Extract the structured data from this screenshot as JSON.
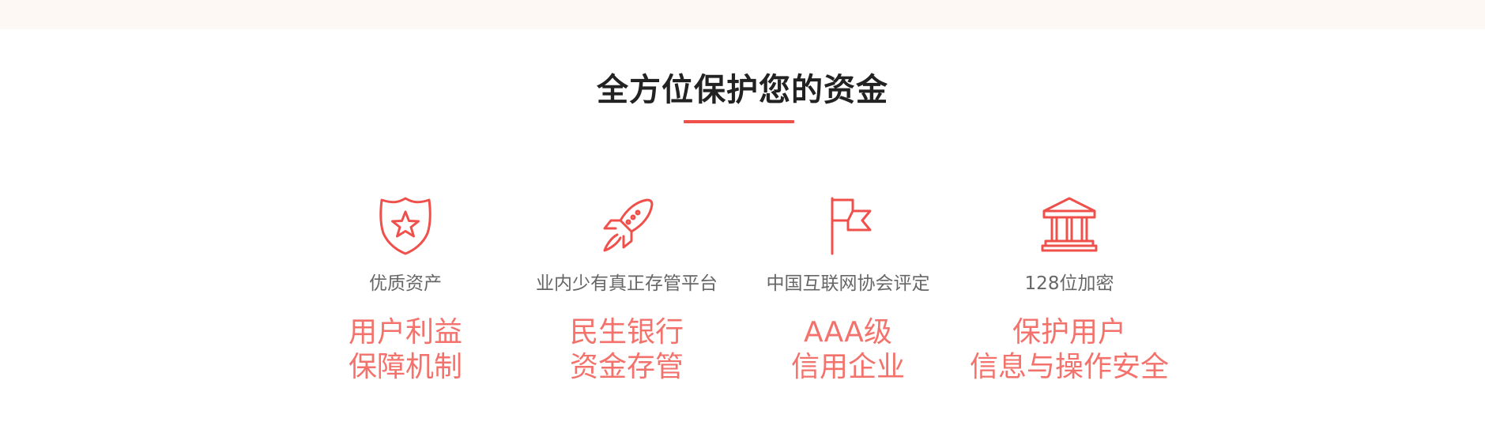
{
  "section": {
    "title": "全方位保护您的资金"
  },
  "colors": {
    "accent": "#f0504b",
    "highlight_text": "#f3726c",
    "top_strip": "#fdf8f3"
  },
  "features": [
    {
      "icon": "shield-star-icon",
      "subtitle": "优质资产",
      "line1": "用户利益",
      "line2": "保障机制"
    },
    {
      "icon": "rocket-icon",
      "subtitle": "业内少有真正存管平台",
      "line1": "民生银行",
      "line2": "资金存管"
    },
    {
      "icon": "flag-icon",
      "subtitle": "中国互联网协会评定",
      "line1": "AAA级",
      "line2": "信用企业"
    },
    {
      "icon": "bank-building-icon",
      "subtitle": "128位加密",
      "line1": "保护用户",
      "line2": "信息与操作安全"
    }
  ]
}
